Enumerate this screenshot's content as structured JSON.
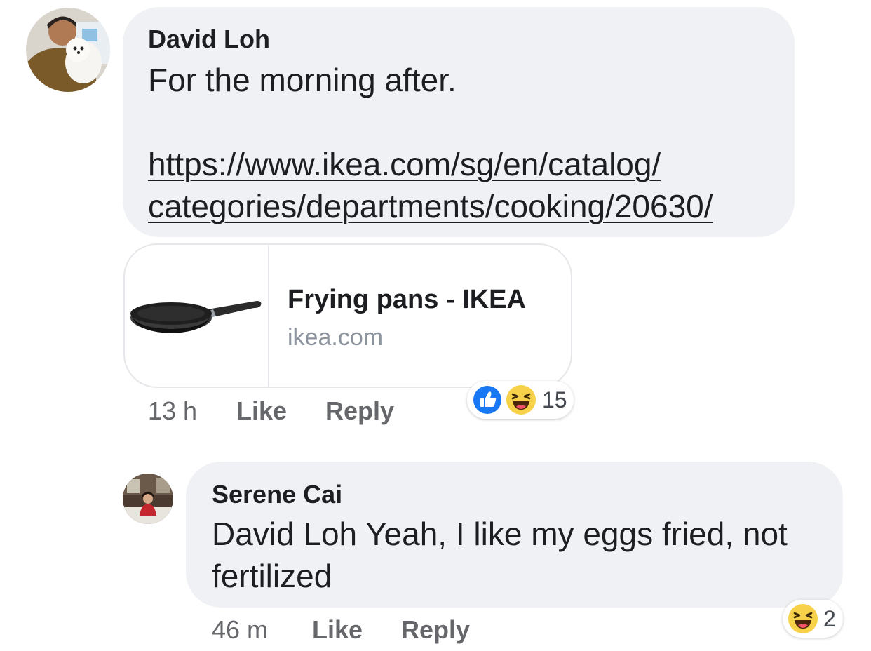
{
  "comments": [
    {
      "author": "David Loh",
      "text": "For the morning after.",
      "link_line1": "https://www.ikea.com/sg/en/catalog/",
      "link_line2": "categories/departments/cooking/20630/",
      "preview": {
        "title": "Frying pans - IKEA",
        "domain": "ikea.com",
        "thumbnail_icon": "frying-pan"
      },
      "time": "13 h",
      "like_label": "Like",
      "reply_label": "Reply",
      "reactions": {
        "icons": [
          "like-icon",
          "haha-icon"
        ],
        "count": "15"
      }
    },
    {
      "author": "Serene Cai",
      "text_line1": "David Loh Yeah, I like my eggs fried, not",
      "text_line2": "fertilized",
      "time": "46 m",
      "like_label": "Like",
      "reply_label": "Reply",
      "reactions": {
        "icons": [
          "haha-icon"
        ],
        "count": "2"
      }
    }
  ],
  "colors": {
    "bubble": "#f0f1f4",
    "text": "#1c1e21",
    "secondary": "#65676b",
    "domain": "#8d949e",
    "like_blue": "#1877f2",
    "haha_yellow": "#f7d14a"
  }
}
